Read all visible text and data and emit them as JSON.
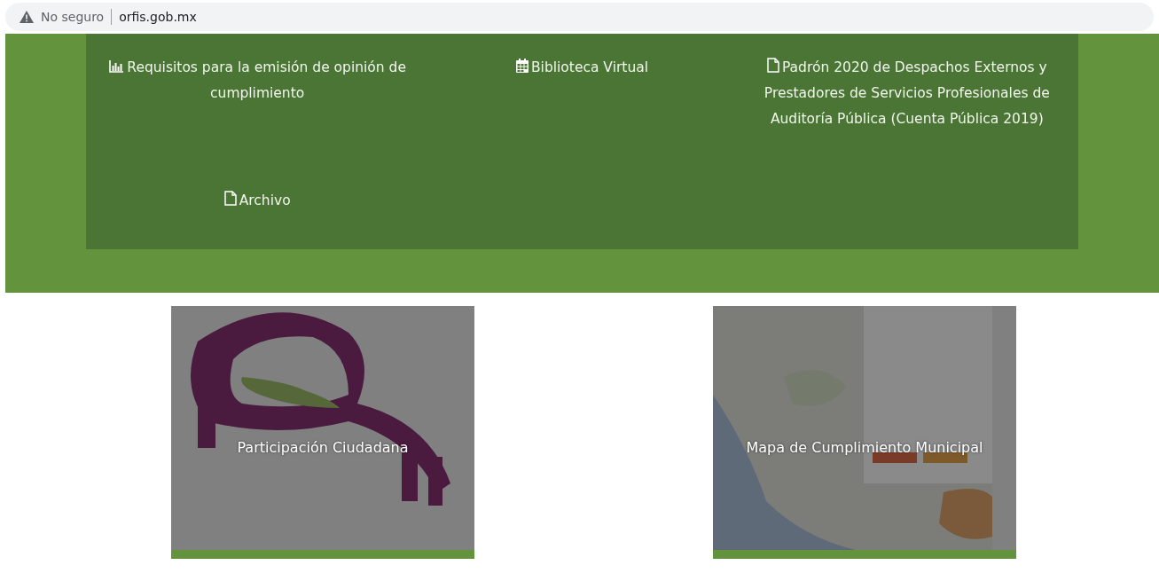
{
  "address_bar": {
    "security": "No seguro",
    "url": "orfis.gob.mx"
  },
  "links": [
    {
      "kind": "chart",
      "label": "Requisitos para la emisión de opinión de cumplimiento"
    },
    {
      "kind": "calendar",
      "label": "Biblioteca Virtual"
    },
    {
      "kind": "document",
      "label": "Padrón 2020 de Despachos Externos y Prestadores de Servicios Profesionales de Auditoría Pública (Cuenta Pública 2019)"
    },
    {
      "kind": "document",
      "label": "Archivo"
    }
  ],
  "cards": [
    {
      "kind": "people",
      "title": "Participación Ciudadana"
    },
    {
      "kind": "map",
      "title": "Mapa de Cumplimiento Municipal"
    }
  ]
}
